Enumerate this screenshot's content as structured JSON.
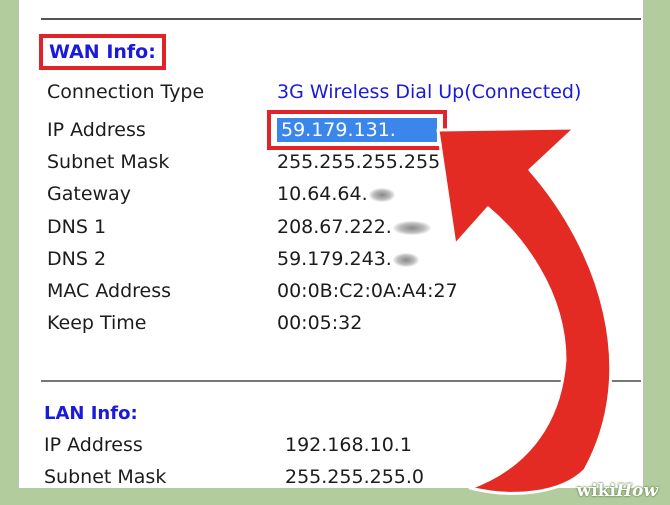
{
  "wan": {
    "title": "WAN Info:",
    "rows": [
      {
        "label": "Connection Type",
        "value": "3G Wireless Dial Up(Connected)"
      },
      {
        "label": "IP Address",
        "value": "59.179.131."
      },
      {
        "label": "Subnet Mask",
        "value": "255.255.255.255"
      },
      {
        "label": "Gateway",
        "value": "10.64.64."
      },
      {
        "label": "DNS 1",
        "value": "208.67.222."
      },
      {
        "label": "DNS 2",
        "value": "59.179.243."
      },
      {
        "label": "MAC Address",
        "value": "00:0B:C2:0A:A4:27"
      },
      {
        "label": "Keep Time",
        "value": "00:05:32"
      }
    ]
  },
  "lan": {
    "title": "LAN Info:",
    "rows": [
      {
        "label": "IP Address",
        "value": "192.168.10.1"
      },
      {
        "label": "Subnet Mask",
        "value": "255.255.255.0"
      }
    ]
  },
  "watermark": {
    "wiki": "wiki",
    "how": "How"
  },
  "colors": {
    "background": "#b3cc9d",
    "highlight_border": "#e0242a",
    "arrow": "#e32b24",
    "title_blue": "#1a1adc",
    "selection": "#3b86ea"
  },
  "icons": {
    "arrow": "curved-arrow-icon"
  }
}
